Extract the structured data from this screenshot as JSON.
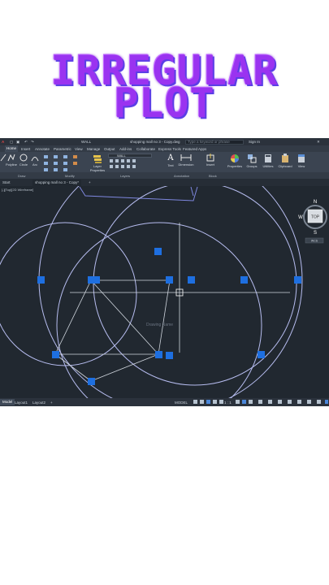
{
  "title": {
    "line1": "IRREGULAR",
    "line2": "PLOT"
  },
  "app": {
    "quick_access": {
      "layer": "WALL",
      "filename": "shopping mall no 3 - Copy.dwg",
      "search_placeholder": "Type a keyword or phrase",
      "signin": "Sign In"
    },
    "ribbon_tabs": [
      "Home",
      "Insert",
      "Annotate",
      "Parametric",
      "View",
      "Manage",
      "Output",
      "Add-ins",
      "Collaborate",
      "Express Tools",
      "Featured Apps"
    ],
    "active_tab": "Home",
    "tools": {
      "line": "Line",
      "polyline": "Polyline",
      "circle": "Circle",
      "arc": "Arc",
      "layer_properties": "Layer Properties",
      "layer_name": "WALL",
      "text": "Text",
      "dimension": "Dimension",
      "insert": "Insert",
      "properties": "Properties",
      "groups": "Groups",
      "utilities": "Utilities",
      "clipboard": "Clipboard",
      "view": "View"
    },
    "panels": [
      "Draw",
      "Modify",
      "Layers",
      "Annotation",
      "Block"
    ],
    "file_tabs": {
      "start": "Start",
      "drawing": "shopping mall no 3 - Copy*"
    },
    "viewport_label": "[-][Top][2D Wireframe]",
    "viewcube": {
      "top": "TOP",
      "n": "N",
      "s": "S",
      "w": "W",
      "e": "E",
      "wcs": "WCS"
    },
    "canvas_text": "Drawing Name",
    "status": {
      "tabs": [
        "Model",
        "Layout1",
        "Layout2"
      ],
      "model_label": "MODEL",
      "scale": "1 : 1"
    }
  },
  "colors": {
    "title": "#9a33f0",
    "title_shadow": "#5b3ee6",
    "canvas_bg": "#212830",
    "circle": "#b7bdf0",
    "grip": "#1e6fe0",
    "line": "#d0d6de"
  }
}
